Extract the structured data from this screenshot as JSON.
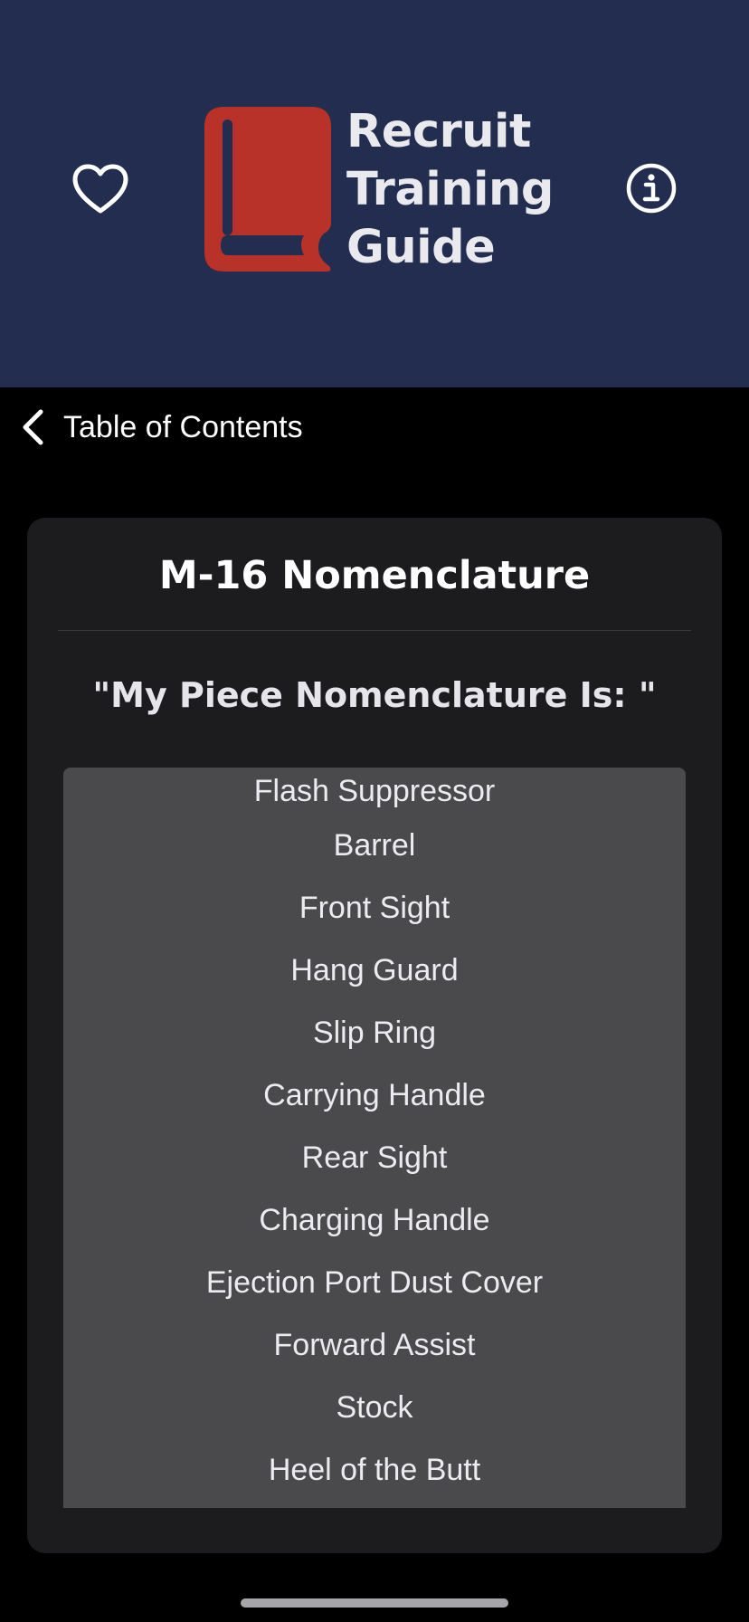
{
  "header": {
    "title_lines": [
      "Recruit",
      "Training",
      "Guide"
    ],
    "favorite_icon": "heart-icon",
    "info_icon": "info-icon",
    "logo_icon": "book-icon",
    "background_color": "#232d4f",
    "logo_color": "#b83229"
  },
  "nav": {
    "back_label": "Table of Contents",
    "back_icon": "chevron-left-icon"
  },
  "card": {
    "title": "M-16 Nomenclature",
    "subtitle": "\"My Piece Nomenclature Is: \"",
    "parts": [
      "Flash Suppressor",
      "Barrel",
      "Front Sight",
      "Hang Guard",
      "Slip Ring",
      "Carrying Handle",
      "Rear Sight",
      "Charging Handle",
      "Ejection Port Dust Cover",
      "Forward Assist",
      "Stock",
      "Heel of the Butt"
    ]
  }
}
